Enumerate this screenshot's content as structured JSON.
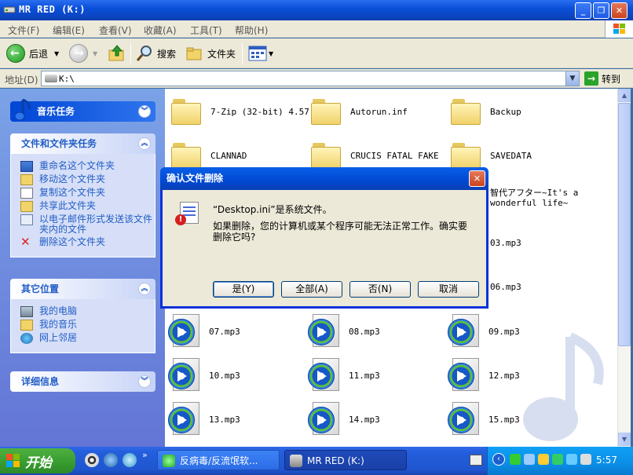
{
  "window": {
    "title": "MR RED (K:)"
  },
  "menu": [
    "文件(F)",
    "编辑(E)",
    "查看(V)",
    "收藏(A)",
    "工具(T)",
    "帮助(H)"
  ],
  "toolbar": {
    "back": "后退",
    "search": "搜索",
    "folders": "文件夹"
  },
  "address": {
    "label": "地址(D)",
    "value": "K:\\",
    "go": "转到"
  },
  "sidebar": {
    "music_tasks": "音乐任务",
    "file_tasks": {
      "title": "文件和文件夹任务",
      "items": [
        "重命名这个文件夹",
        "移动这个文件夹",
        "复制这个文件夹",
        "共享此文件夹",
        "以电子邮件形式发送该文件夹内的文件",
        "删除这个文件夹"
      ]
    },
    "other_places": {
      "title": "其它位置",
      "items": [
        "我的电脑",
        "我的音乐",
        "网上邻居"
      ]
    },
    "details": "详细信息"
  },
  "files": {
    "folders": [
      "7-Zip (32-bit) 4.57",
      "Autorun.inf",
      "Backup",
      "CLANNAD",
      "CRUCIS FATAL FAKE",
      "SAVEDATA"
    ],
    "partial_folder_name": "智代アフター~It's a wonderful life~",
    "mp3_partial": [
      "03.mp3",
      "06.mp3"
    ],
    "mp3": [
      "07.mp3",
      "08.mp3",
      "09.mp3",
      "10.mp3",
      "11.mp3",
      "12.mp3",
      "13.mp3",
      "14.mp3",
      "15.mp3"
    ]
  },
  "dialog": {
    "title": "确认文件删除",
    "line1": "“Desktop.ini”是系统文件。",
    "line2": "如果删除，您的计算机或某个程序可能无法正常工作。确实要删除它吗?",
    "buttons": [
      "是(Y)",
      "全部(A)",
      "否(N)",
      "取消"
    ]
  },
  "taskbar": {
    "start": "开始",
    "tasks": [
      "反病毒/反流氓软...",
      "MR RED (K:)"
    ],
    "clock": "5:57"
  },
  "colors": {
    "title_blue": "#0a4fd8",
    "taskbar_blue": "#245edc",
    "start_green": "#379b2e",
    "link_blue": "#215dc6"
  }
}
